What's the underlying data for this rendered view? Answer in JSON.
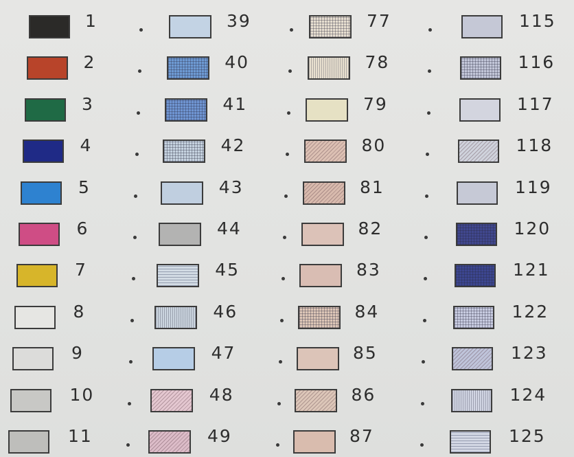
{
  "columns": [
    {
      "items": [
        {
          "label": "1",
          "fill": "#2b2a28",
          "pattern": "solid"
        },
        {
          "label": "2",
          "fill": "#b8442a",
          "pattern": "solid"
        },
        {
          "label": "3",
          "fill": "#1f6a45",
          "pattern": "solid"
        },
        {
          "label": "4",
          "fill": "#1f2a86",
          "pattern": "solid"
        },
        {
          "label": "5",
          "fill": "#2e82d0",
          "pattern": "solid"
        },
        {
          "label": "6",
          "fill": "#cf4d85",
          "pattern": "solid"
        },
        {
          "label": "7",
          "fill": "#d7b52a",
          "pattern": "solid"
        },
        {
          "label": "8",
          "fill": "#e6e6e3",
          "pattern": "solid"
        },
        {
          "label": "9",
          "fill": "#dcdcda",
          "pattern": "solid"
        },
        {
          "label": "10",
          "fill": "#c8c8c5",
          "pattern": "solid"
        },
        {
          "label": "11",
          "fill": "#bebebb",
          "pattern": "solid"
        }
      ]
    },
    {
      "items": [
        {
          "label": "39",
          "fill": "#c3d3e4",
          "pattern": "solid"
        },
        {
          "label": "40",
          "fill": "#6e9ad3",
          "pattern": "grid"
        },
        {
          "label": "41",
          "fill": "#6f95d2",
          "pattern": "grid"
        },
        {
          "label": "42",
          "fill": "#c5d2df",
          "pattern": "grid"
        },
        {
          "label": "43",
          "fill": "#c0cfe0",
          "pattern": "solid"
        },
        {
          "label": "44",
          "fill": "#b3b3b2",
          "pattern": "solid"
        },
        {
          "label": "45",
          "fill": "#d2dbe4",
          "pattern": "hlines"
        },
        {
          "label": "46",
          "fill": "#cbd5df",
          "pattern": "vlines"
        },
        {
          "label": "47",
          "fill": "#b6cde6",
          "pattern": "solid"
        },
        {
          "label": "48",
          "fill": "#e4c7d0",
          "pattern": "diag"
        },
        {
          "label": "49",
          "fill": "#dcbcc8",
          "pattern": "diag"
        }
      ]
    },
    {
      "items": [
        {
          "label": "77",
          "fill": "#e6ded0",
          "pattern": "grid"
        },
        {
          "label": "78",
          "fill": "#e8e0cf",
          "pattern": "vlines"
        },
        {
          "label": "79",
          "fill": "#e6e1c4",
          "pattern": "solid"
        },
        {
          "label": "80",
          "fill": "#dcc0b3",
          "pattern": "diag"
        },
        {
          "label": "81",
          "fill": "#d8baad",
          "pattern": "diag"
        },
        {
          "label": "82",
          "fill": "#dcc2b8",
          "pattern": "solid"
        },
        {
          "label": "83",
          "fill": "#d9bdb3",
          "pattern": "solid"
        },
        {
          "label": "84",
          "fill": "#dcc5b6",
          "pattern": "grid"
        },
        {
          "label": "85",
          "fill": "#dcc4b8",
          "pattern": "solid"
        },
        {
          "label": "86",
          "fill": "#dcc6b8",
          "pattern": "diag"
        },
        {
          "label": "87",
          "fill": "#d9bcae",
          "pattern": "solid"
        }
      ]
    },
    {
      "items": [
        {
          "label": "115",
          "fill": "#c5c8d6",
          "pattern": "solid"
        },
        {
          "label": "116",
          "fill": "#c2c6d8",
          "pattern": "grid"
        },
        {
          "label": "117",
          "fill": "#d3d5df",
          "pattern": "solid"
        },
        {
          "label": "118",
          "fill": "#cfd2dc",
          "pattern": "diag"
        },
        {
          "label": "119",
          "fill": "#c6c9d6",
          "pattern": "solid"
        },
        {
          "label": "120",
          "fill": "#40478e",
          "pattern": "grid"
        },
        {
          "label": "121",
          "fill": "#3c4690",
          "pattern": "grid"
        },
        {
          "label": "122",
          "fill": "#c7cbe0",
          "pattern": "grid"
        },
        {
          "label": "123",
          "fill": "#bfc4da",
          "pattern": "diag"
        },
        {
          "label": "124",
          "fill": "#d1d5e3",
          "pattern": "vlines"
        },
        {
          "label": "125",
          "fill": "#d3d7e4",
          "pattern": "hlines"
        }
      ]
    }
  ]
}
